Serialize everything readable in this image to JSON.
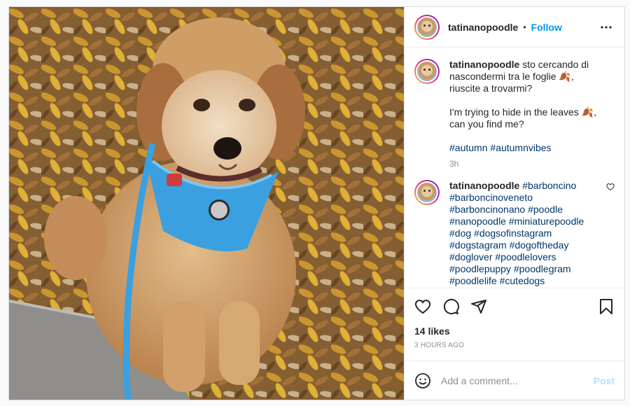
{
  "post": {
    "username": "tatinanopoodle",
    "follow_label": "Follow",
    "dot": "•",
    "caption": {
      "username": "tatinanopoodle",
      "line_it": "sto cercando di nascondermi tra le foglie 🍂, riuscite a trovarmi?",
      "line_en": "I'm trying to hide in the leaves 🍂, can you find me?",
      "hashtags": "#autumn #autumnvibes",
      "time": "3h"
    },
    "comment": {
      "username": "tatinanopoodle",
      "text": "#barboncino #barboncinoveneto #barboncinonano #poodle #nanopoodle #miniaturepoodle #dog #dogsofinstagram #dogstagram #dogoftheday #doglover #poodlelovers #poodlepuppy #poodlegram #poodlelife #cutedogs"
    },
    "likes": "14 likes",
    "posted_ago": "3 HOURS AGO",
    "add_comment_placeholder": "Add a comment...",
    "post_label": "Post"
  },
  "icons": {
    "more": "more-horizontal-icon",
    "like": "heart-icon",
    "comment": "comment-icon",
    "share": "paper-plane-icon",
    "save": "bookmark-icon",
    "emoji": "emoji-icon"
  },
  "colors": {
    "link": "#0095f6",
    "hashtag": "#00376b",
    "muted": "#8e8e8e",
    "post_disabled": "#b2dffc",
    "harness": "#3aa0e0"
  }
}
